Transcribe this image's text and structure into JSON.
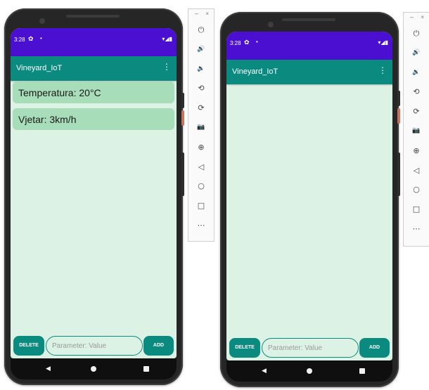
{
  "emulator_left": {
    "status": {
      "time": "3:28",
      "gear": "✿",
      "dot": "•",
      "indicators": "▾◢▮"
    },
    "app_title": "Vineyard_IoT",
    "overflow_icon": "⋮",
    "items": [
      {
        "text": "Temperatura: 20°C"
      },
      {
        "text": "Vjetar: 3km/h"
      }
    ],
    "delete_label": "DELETE",
    "input_placeholder": "Parameter: Value",
    "add_label": "ADD",
    "nav": {
      "back": "◀"
    }
  },
  "emulator_right": {
    "status": {
      "time": "3:28",
      "gear": "✿",
      "dot": "•",
      "indicators": "▾◢▮"
    },
    "app_title": "Vineyard_IoT",
    "overflow_icon": "⋮",
    "items": [],
    "delete_label": "DELETE",
    "input_placeholder": "Parameter: Value",
    "add_label": "ADD",
    "nav": {
      "back": "◀"
    }
  },
  "toolbar": {
    "minimize": "–",
    "close": "×",
    "icons": [
      {
        "name": "power-icon",
        "glyph": "⏻"
      },
      {
        "name": "volume-up-icon",
        "glyph": "🔊"
      },
      {
        "name": "volume-down-icon",
        "glyph": "🔉"
      },
      {
        "name": "rotate-left-icon",
        "glyph": "⟲"
      },
      {
        "name": "rotate-right-icon",
        "glyph": "⟳"
      },
      {
        "name": "camera-icon",
        "glyph": "📷"
      },
      {
        "name": "zoom-icon",
        "glyph": "⊕"
      },
      {
        "name": "back-icon",
        "glyph": "◁"
      },
      {
        "name": "home-icon",
        "glyph": "○"
      },
      {
        "name": "overview-icon",
        "glyph": "□"
      },
      {
        "name": "more-icon",
        "glyph": "⋯"
      }
    ]
  },
  "colors": {
    "status_bar": "#4a0fd0",
    "app_bar": "#0b8a80",
    "background": "#dcf2e4",
    "item": "#a8ddb9"
  }
}
